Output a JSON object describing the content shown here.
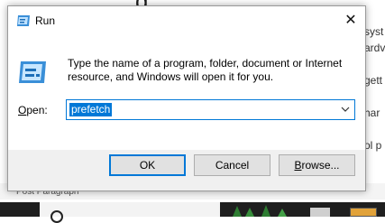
{
  "background": {
    "right_fragments": [
      "syst",
      "ardv",
      "",
      "gett",
      "",
      "har",
      "",
      "ol p"
    ],
    "footer_text": "Post   Paragraph"
  },
  "dialog": {
    "title": "Run",
    "description": "Type the name of a program, folder, document or Internet resource, and Windows will open it for you.",
    "open_label_prefix": "O",
    "open_label_rest": "pen:",
    "open_value": "prefetch",
    "ok_label": "OK",
    "cancel_label": "Cancel",
    "browse_label_prefix": "B",
    "browse_label_rest": "rowse...",
    "close_glyph": "✕"
  },
  "colors": {
    "accent": "#0078d7",
    "dialog_bg": "#f0f0f0",
    "button_bg": "#e1e1e1"
  },
  "icons": [
    "run-app-icon",
    "run-large-icon",
    "chevron-down-icon",
    "close-icon",
    "search-icon"
  ]
}
